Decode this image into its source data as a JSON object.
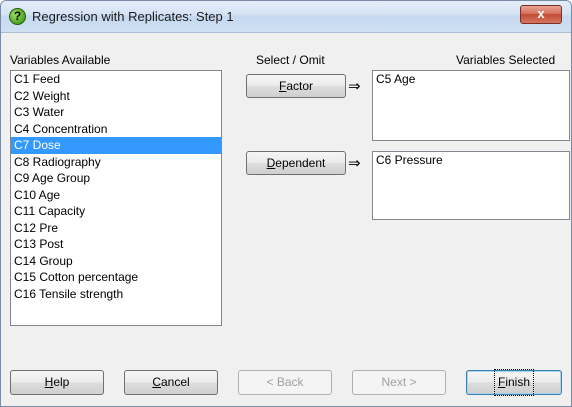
{
  "window": {
    "title": "Regression with Replicates: Step 1",
    "close_label": "x"
  },
  "labels": {
    "variables_available": "Variables Available",
    "select_omit": "Select / Omit",
    "variables_selected": "Variables Selected"
  },
  "available_variables": [
    "C1 Feed",
    "C2 Weight",
    "C3 Water",
    "C4 Concentration",
    "C7 Dose",
    "C8 Radiography",
    "C9 Age Group",
    "C10 Age",
    "C11 Capacity",
    "C12 Pre",
    "C13 Post",
    "C14 Group",
    "C15 Cotton percentage",
    "C16 Tensile strength"
  ],
  "selected_index": 4,
  "factor": {
    "button_label": "Factor",
    "arrow": "⇒",
    "values": [
      "C5 Age"
    ]
  },
  "dependent": {
    "button_label": "Dependent",
    "arrow": "⇒",
    "values": [
      "C6 Pressure"
    ]
  },
  "buttons": {
    "help": "Help",
    "cancel": "Cancel",
    "back": "< Back",
    "next": "Next >",
    "finish": "Finish"
  },
  "colors": {
    "selection": "#3399ff",
    "close_button": "#c24a32",
    "help_icon": "#2f8a12"
  }
}
